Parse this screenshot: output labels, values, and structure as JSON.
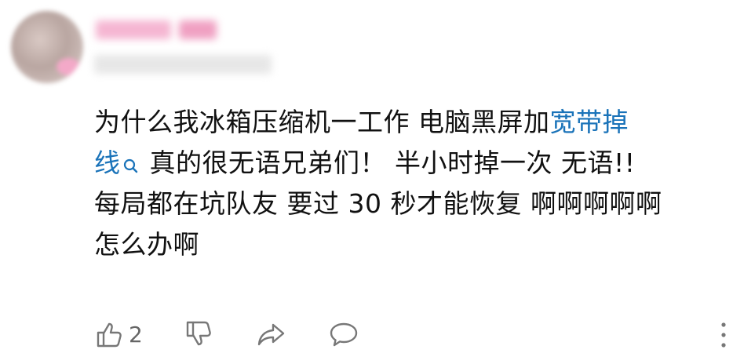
{
  "comment": {
    "lines": [
      {
        "before": "为什么我冰箱压缩机一工作 电脑黑屏加",
        "link": "宽带掉"
      },
      {
        "link": "线",
        "after": " 真的很无语兄弟们！  半小时掉一次 无语!!"
      },
      {
        "text": "每局都在坑队友 要过 30 秒才能恢复 啊啊啊啊啊"
      },
      {
        "text": "怎么办啊"
      }
    ]
  },
  "actions": {
    "like_count": "2"
  },
  "colors": {
    "link": "#1a73b9",
    "icon": "#777777"
  }
}
